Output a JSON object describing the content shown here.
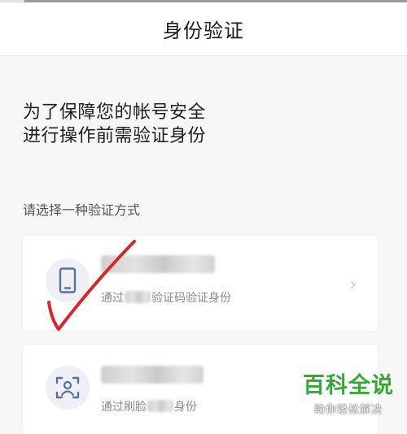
{
  "header": {
    "title": "身份验证"
  },
  "headline": {
    "line1": "为了保障您的帐号安全",
    "line2": "进行操作前需验证身份"
  },
  "prompt": "请选择一种验证方式",
  "options": [
    {
      "icon": "phone-icon",
      "sub_prefix": "通过",
      "sub_suffix": "验证码验证身份",
      "chevron": "›"
    },
    {
      "icon": "face-scan-icon",
      "sub_prefix": "通过刷脸",
      "sub_suffix": "身份"
    }
  ],
  "watermark": {
    "title": "百科全说",
    "subtitle": "助你轻松解决"
  },
  "colors": {
    "accent": "#5a6ea0",
    "check_mark": "#d6282a",
    "watermark_green": "#33aa33"
  }
}
